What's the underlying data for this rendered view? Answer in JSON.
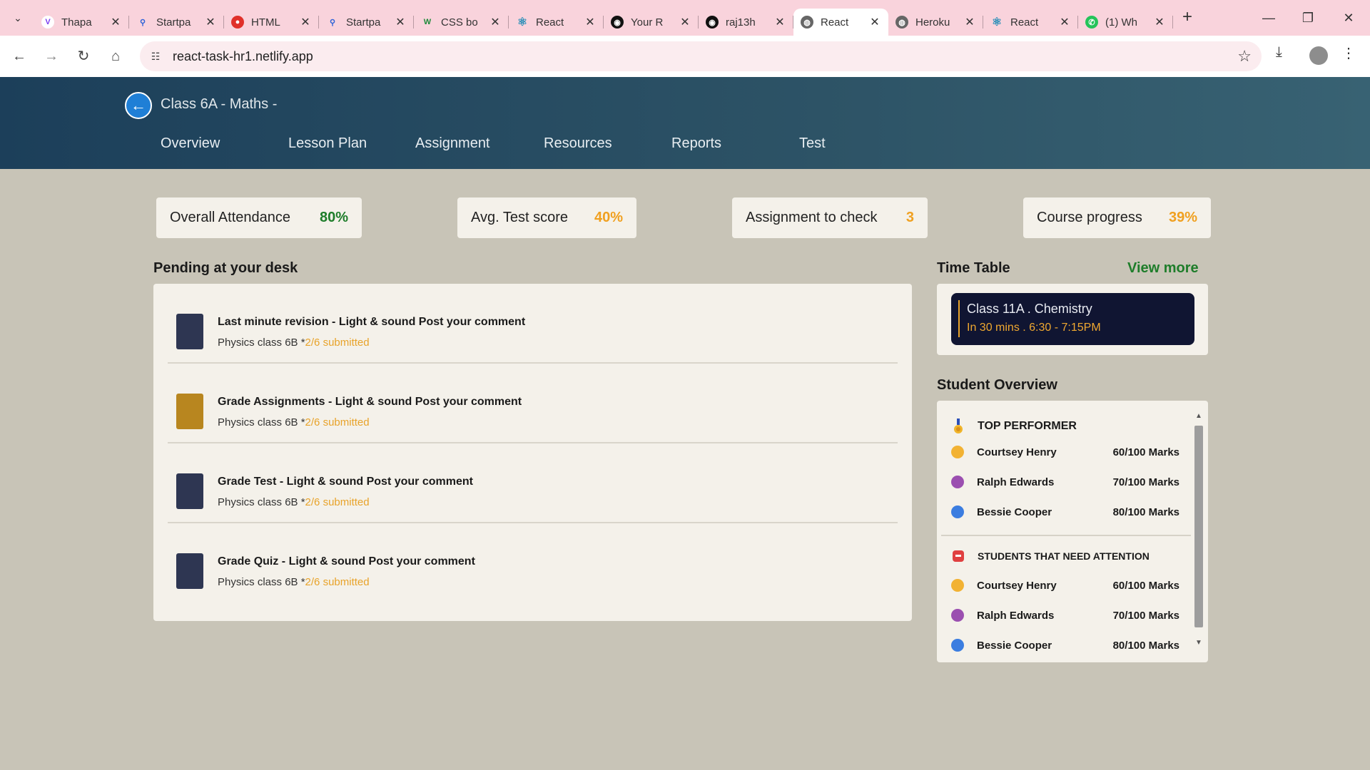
{
  "browser": {
    "tabs": [
      {
        "title": "Thapa",
        "favicon_color": "#7b3ff2",
        "glyph": "V"
      },
      {
        "title": "Startpa",
        "favicon_color": "#2f63d8",
        "glyph": "🔍"
      },
      {
        "title": "HTML",
        "favicon_color": "#e0302a",
        "glyph": "●"
      },
      {
        "title": "Startpa",
        "favicon_color": "#2f63d8",
        "glyph": "🔍"
      },
      {
        "title": "CSS bo",
        "favicon_color": "#1e8a3a",
        "glyph": "W"
      },
      {
        "title": "React",
        "favicon_color": "#2b8fb8",
        "glyph": "⚛"
      },
      {
        "title": "Your R",
        "favicon_color": "#111111",
        "glyph": "◉"
      },
      {
        "title": "raj13h",
        "favicon_color": "#111111",
        "glyph": "◉"
      },
      {
        "title": "React",
        "favicon_color": "#666666",
        "glyph": "◍"
      },
      {
        "title": "Heroku",
        "favicon_color": "#666666",
        "glyph": "◍"
      },
      {
        "title": "React",
        "favicon_color": "#2b8fb8",
        "glyph": "⚛"
      },
      {
        "title": "(1) Wh",
        "favicon_color": "#25c35a",
        "glyph": "✆"
      }
    ],
    "active_tab_index": 8,
    "url": "react-task-hr1.netlify.app",
    "icons": {
      "tab_menu": "chevron-down-icon",
      "new_tab": "plus-icon",
      "minimize": "minimize-icon",
      "restore": "restore-icon",
      "close": "close-icon",
      "back": "arrow-left-icon",
      "forward": "arrow-right-icon",
      "reload": "reload-icon",
      "home": "home-icon",
      "site_info": "tune-icon",
      "bookmark": "star-icon",
      "download": "download-icon",
      "menu": "kebab-icon"
    }
  },
  "header": {
    "class_title": "Class 6A - Maths -",
    "nav": [
      "Overview",
      "Lesson Plan",
      "Assignment",
      "Resources",
      "Reports",
      "Test"
    ]
  },
  "stats": [
    {
      "label": "Overall Attendance",
      "value": "80%",
      "color": "#1e7d2a"
    },
    {
      "label": "Avg. Test score",
      "value": "40%",
      "color": "#f0a020"
    },
    {
      "label": "Assignment to check",
      "value": "3",
      "color": "#f0a020"
    },
    {
      "label": "Course progress",
      "value": "39%",
      "color": "#f0a020"
    }
  ],
  "pending": {
    "title": "Pending at your desk",
    "items": [
      {
        "title": "Last minute revision - Light & sound Post your comment",
        "sub_prefix": "Physics class 6B *",
        "sub_status": "2/6 submitted",
        "color": "#2e3652"
      },
      {
        "title": "Grade Assignments - Light & sound Post your comment",
        "sub_prefix": "Physics class 6B *",
        "sub_status": "2/6 submitted",
        "color": "#b8861f"
      },
      {
        "title": "Grade Test - Light & sound Post your comment",
        "sub_prefix": "Physics class 6B *",
        "sub_status": "2/6 submitted",
        "color": "#2e3652"
      },
      {
        "title": "Grade Quiz - Light & sound Post your comment",
        "sub_prefix": "Physics class 6B *",
        "sub_status": "2/6 submitted",
        "color": "#2e3652"
      }
    ]
  },
  "timetable": {
    "title": "Time Table",
    "view_more": "View more",
    "entry_class": "Class 11A . Chemistry",
    "entry_time": "In 30 mins . 6:30 - 7:15PM"
  },
  "student_overview": {
    "title": "Student Overview",
    "top_heading": "TOP PERFORMER",
    "attention_heading": "STUDENTS THAT NEED ATTENTION",
    "top": [
      {
        "name": "Courtsey Henry",
        "marks": "60/100 Marks",
        "avatar_color": "#f2b233"
      },
      {
        "name": "Ralph Edwards",
        "marks": "70/100 Marks",
        "avatar_color": "#9b4fb0"
      },
      {
        "name": "Bessie Cooper",
        "marks": "80/100 Marks",
        "avatar_color": "#3b7de0"
      }
    ],
    "attention": [
      {
        "name": "Courtsey Henry",
        "marks": "60/100 Marks",
        "avatar_color": "#f2b233"
      },
      {
        "name": "Ralph Edwards",
        "marks": "70/100 Marks",
        "avatar_color": "#9b4fb0"
      },
      {
        "name": "Bessie Cooper",
        "marks": "80/100 Marks",
        "avatar_color": "#3b7de0"
      }
    ]
  }
}
